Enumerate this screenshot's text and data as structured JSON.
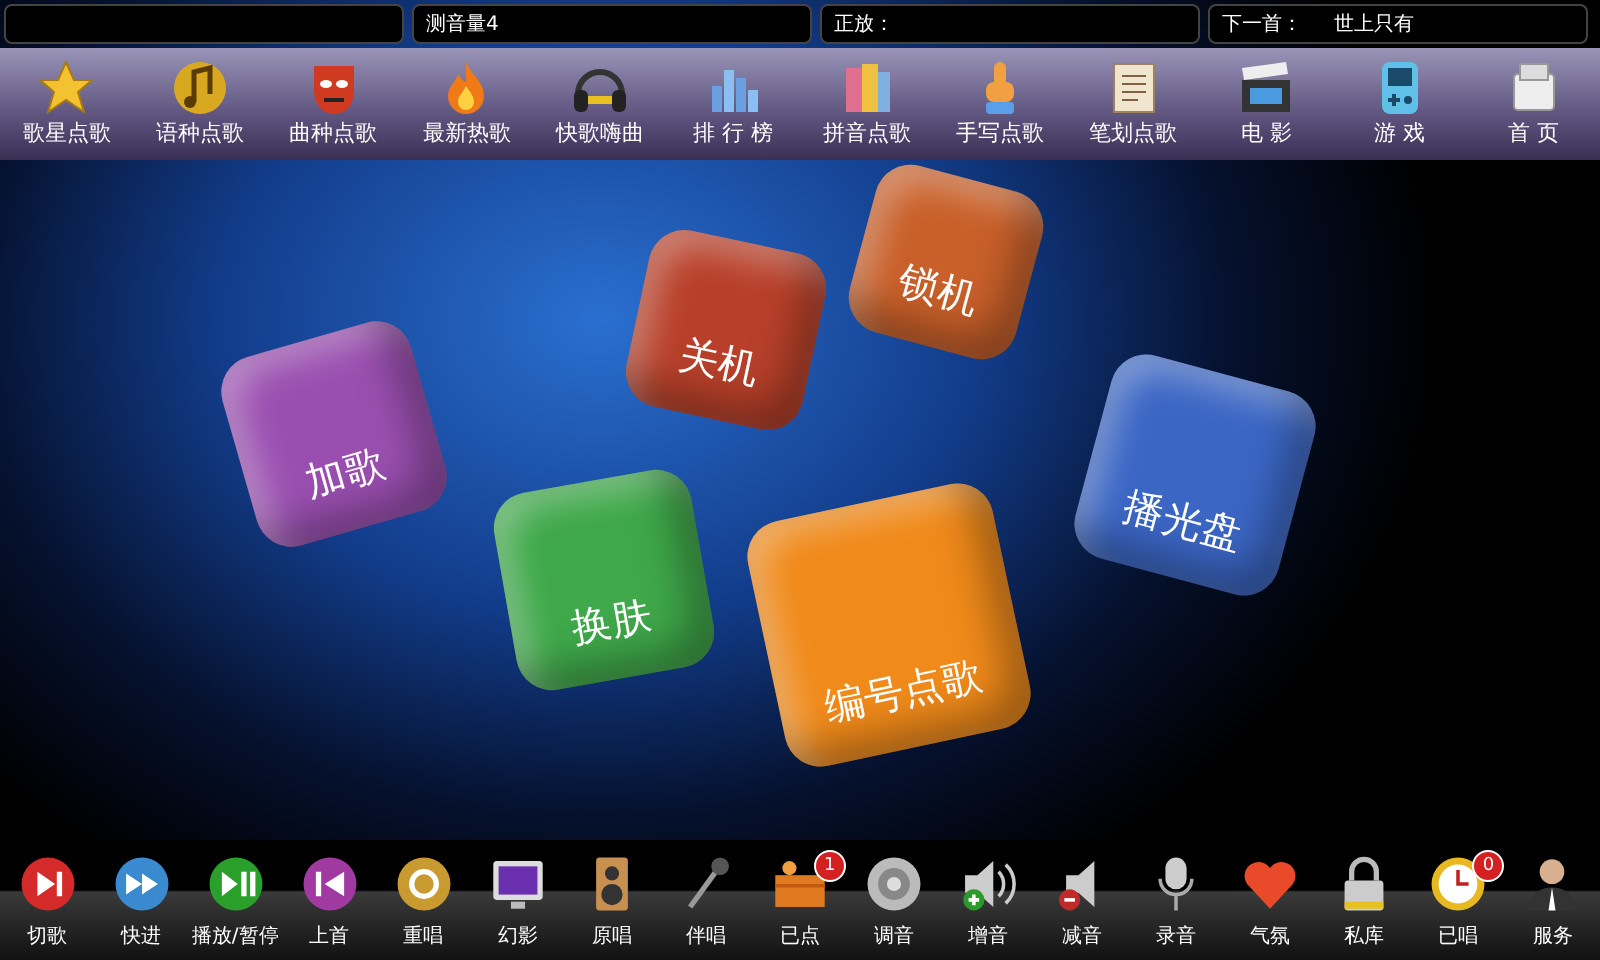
{
  "status_fields": [
    {
      "label": "测音量4"
    },
    {
      "label": "正放："
    },
    {
      "label": "下一首：",
      "value": "世上只有"
    }
  ],
  "menu": [
    {
      "label": "歌星点歌"
    },
    {
      "label": "语种点歌"
    },
    {
      "label": "曲种点歌"
    },
    {
      "label": "最新热歌"
    },
    {
      "label": "快歌嗨曲"
    },
    {
      "label": "排 行 榜"
    },
    {
      "label": "拼音点歌"
    },
    {
      "label": "手写点歌"
    },
    {
      "label": "笔划点歌"
    },
    {
      "label": "电 影"
    },
    {
      "label": "游 戏"
    },
    {
      "label": "首 页"
    }
  ],
  "cubes": [
    {
      "label": "加歌",
      "color": "#9a4fb0"
    },
    {
      "label": "关机",
      "color": "#b8402a"
    },
    {
      "label": "锁机",
      "color": "#c9602a"
    },
    {
      "label": "换肤",
      "color": "#3fa84a"
    },
    {
      "label": "编号点歌",
      "color": "#f08a1a"
    },
    {
      "label": "播光盘",
      "color": "#3b66c4"
    }
  ],
  "controls": [
    {
      "label": "切歌"
    },
    {
      "label": "快进"
    },
    {
      "label": "播放/暂停"
    },
    {
      "label": "上首"
    },
    {
      "label": "重唱"
    },
    {
      "label": "幻影"
    },
    {
      "label": "原唱"
    },
    {
      "label": "伴唱"
    },
    {
      "label": "已点",
      "badge": "1"
    },
    {
      "label": "调音"
    },
    {
      "label": "增音"
    },
    {
      "label": "减音"
    },
    {
      "label": "录音"
    },
    {
      "label": "气氛"
    },
    {
      "label": "私库"
    },
    {
      "label": "已唱",
      "badge": "0"
    },
    {
      "label": "服务"
    }
  ]
}
